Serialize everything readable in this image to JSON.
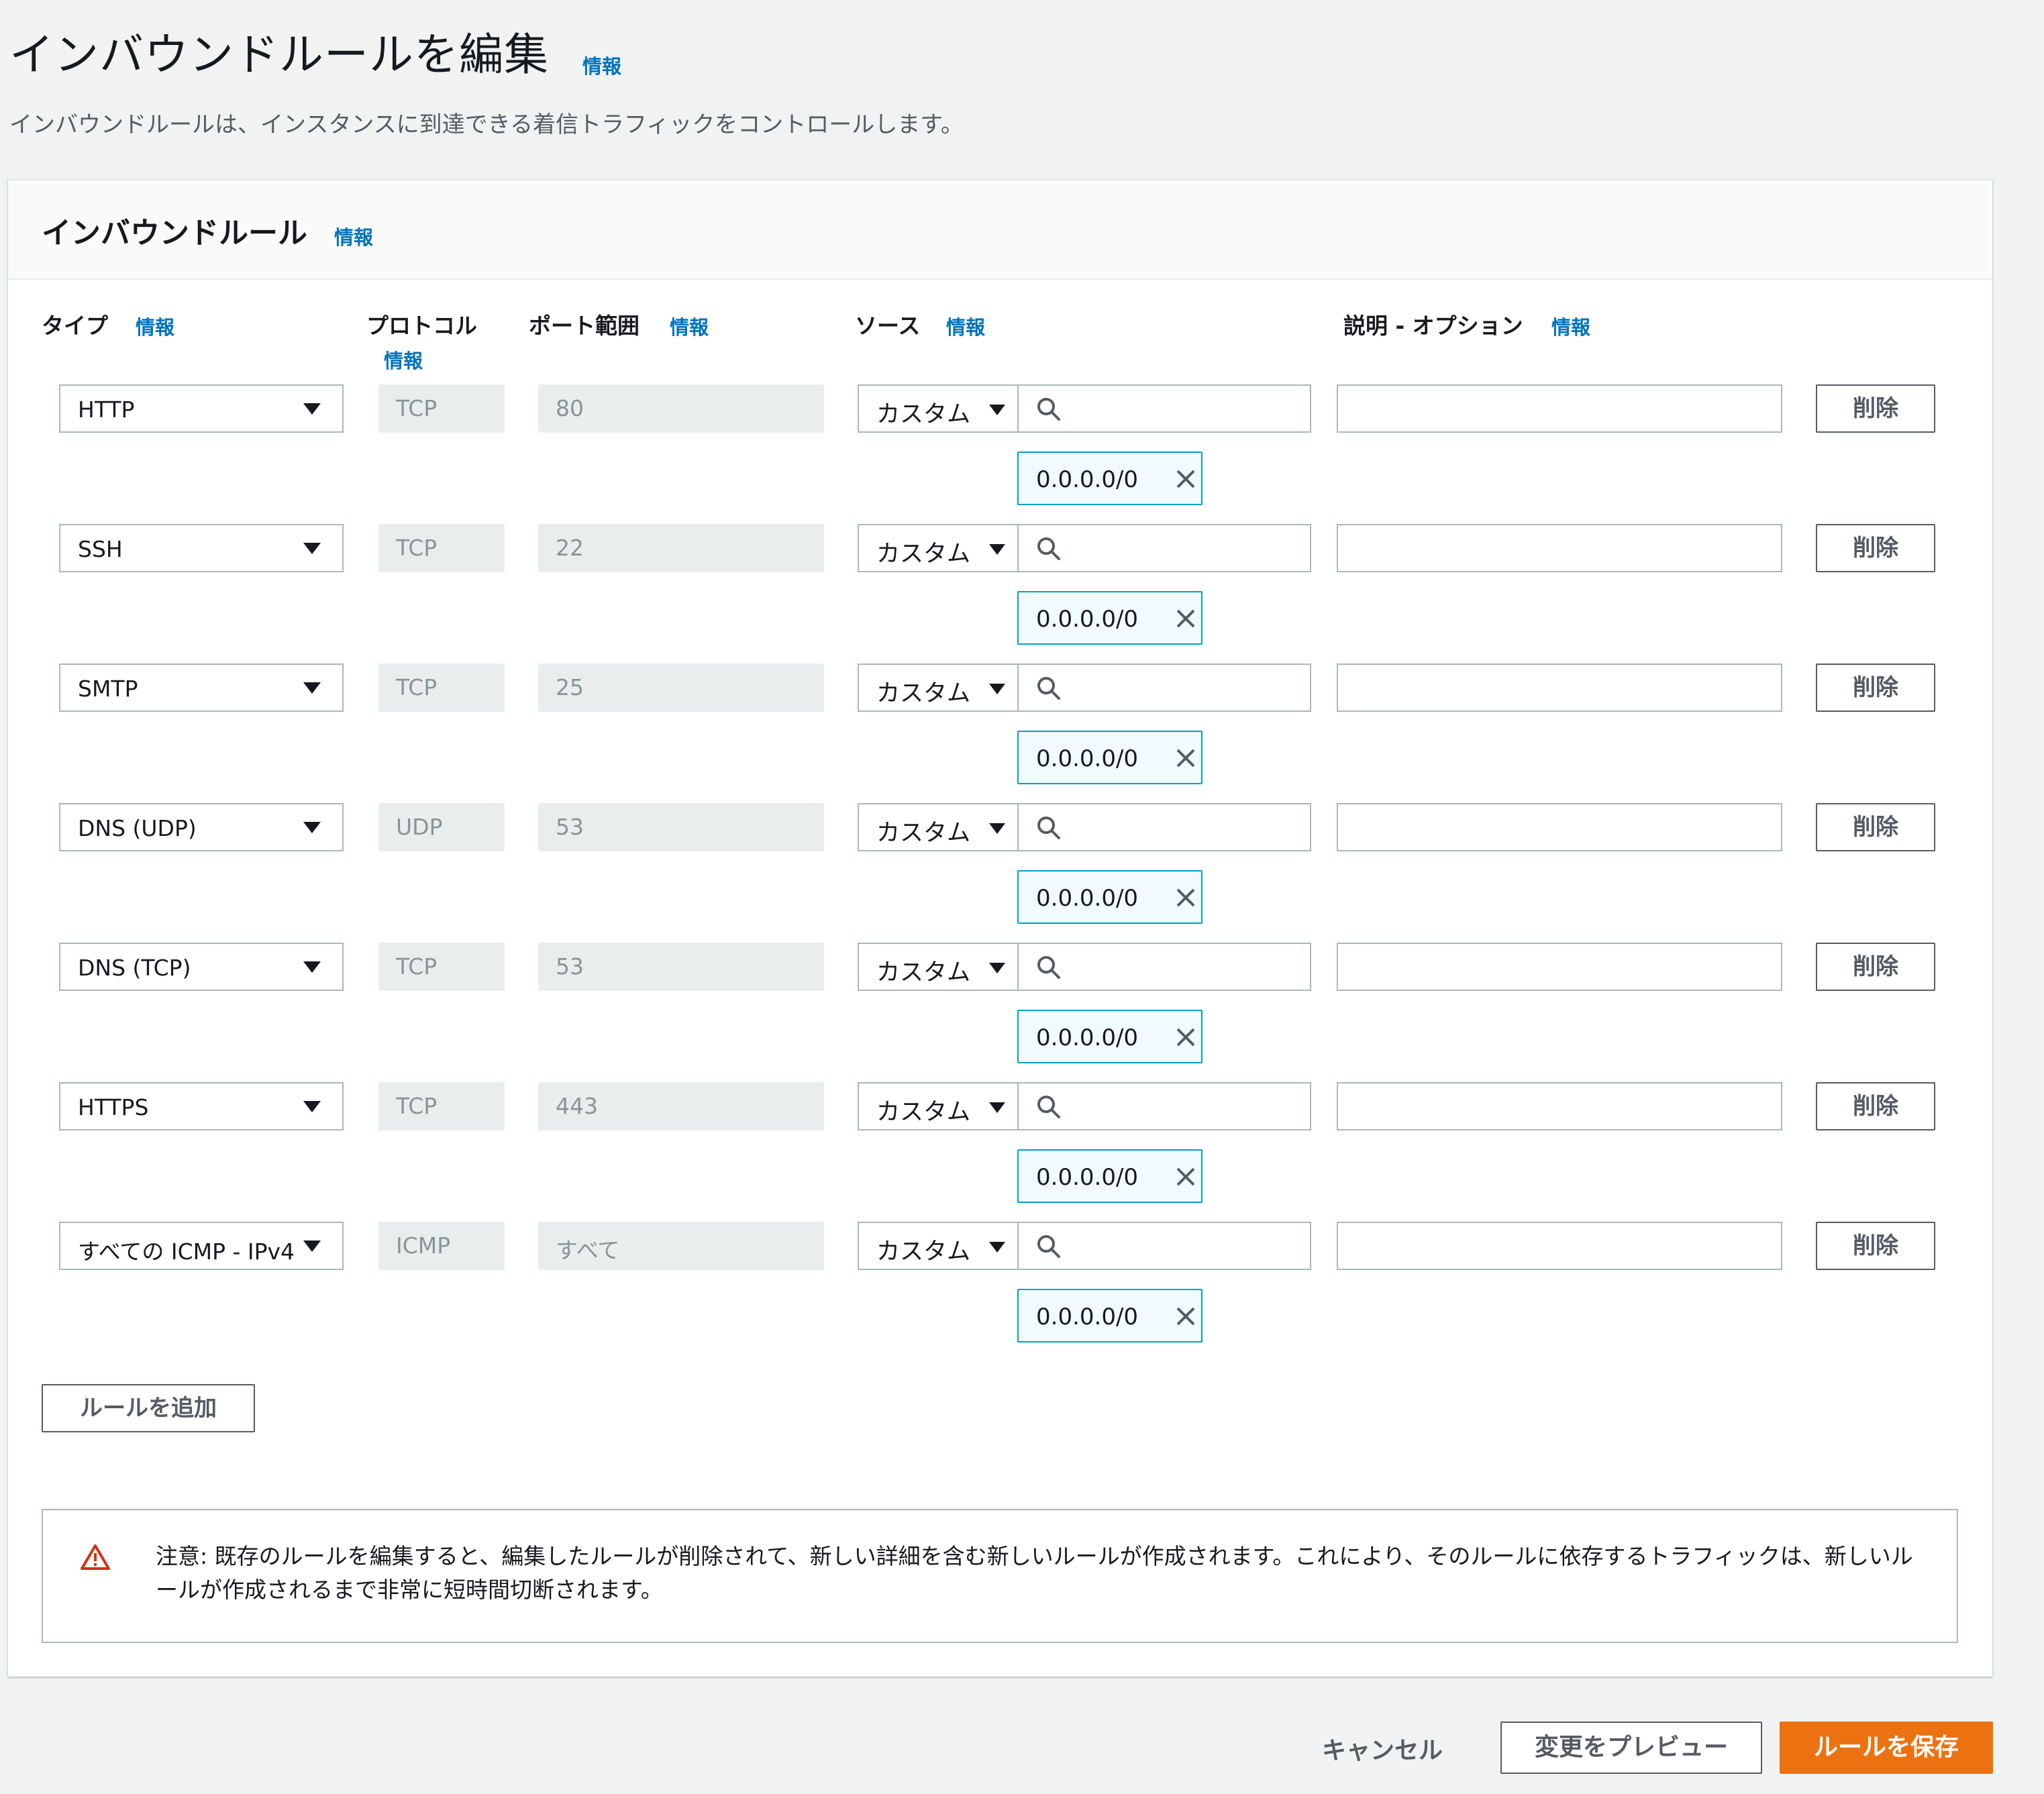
{
  "header": {
    "title": "インバウンドルールを編集",
    "info": "情報",
    "description": "インバウンドルールは、インスタンスに到達できる着信トラフィックをコントロールします。"
  },
  "panel": {
    "title": "インバウンドルール",
    "info": "情報",
    "columns": {
      "type": "タイプ",
      "type_info": "情報",
      "protocol": "プロトコル",
      "protocol_info": "情報",
      "port": "ポート範囲",
      "port_info": "情報",
      "source": "ソース",
      "source_info": "情報",
      "description": "説明 - オプション",
      "description_info": "情報"
    },
    "rules": [
      {
        "type": "HTTP",
        "protocol": "TCP",
        "port": "80",
        "source_type": "カスタム",
        "source_value": "0.0.0.0/0",
        "description": "",
        "delete_label": "削除"
      },
      {
        "type": "SSH",
        "protocol": "TCP",
        "port": "22",
        "source_type": "カスタム",
        "source_value": "0.0.0.0/0",
        "description": "",
        "delete_label": "削除"
      },
      {
        "type": "SMTP",
        "protocol": "TCP",
        "port": "25",
        "source_type": "カスタム",
        "source_value": "0.0.0.0/0",
        "description": "",
        "delete_label": "削除"
      },
      {
        "type": "DNS (UDP)",
        "protocol": "UDP",
        "port": "53",
        "source_type": "カスタム",
        "source_value": "0.0.0.0/0",
        "description": "",
        "delete_label": "削除"
      },
      {
        "type": "DNS (TCP)",
        "protocol": "TCP",
        "port": "53",
        "source_type": "カスタム",
        "source_value": "0.0.0.0/0",
        "description": "",
        "delete_label": "削除"
      },
      {
        "type": "HTTPS",
        "protocol": "TCP",
        "port": "443",
        "source_type": "カスタム",
        "source_value": "0.0.0.0/0",
        "description": "",
        "delete_label": "削除"
      },
      {
        "type": "すべての ICMP - IPv4",
        "protocol": "ICMP",
        "port": "すべて",
        "source_type": "カスタム",
        "source_value": "0.0.0.0/0",
        "description": "",
        "delete_label": "削除"
      }
    ],
    "add_rule_label": "ルールを追加",
    "warning": {
      "icon": "warning-icon",
      "text": "注意: 既存のルールを編集すると、編集したルールが削除されて、新しい詳細を含む新しいルールが作成されます。これにより、そのルールに依存するトラフィックは、新しいルールが作成されるまで非常に短時間切断されます。",
      "color": "#d13212"
    }
  },
  "footer": {
    "cancel_label": "キャンセル",
    "preview_label": "変更をプレビュー",
    "save_label": "ルールを保存",
    "save_color": "#ec7211"
  }
}
